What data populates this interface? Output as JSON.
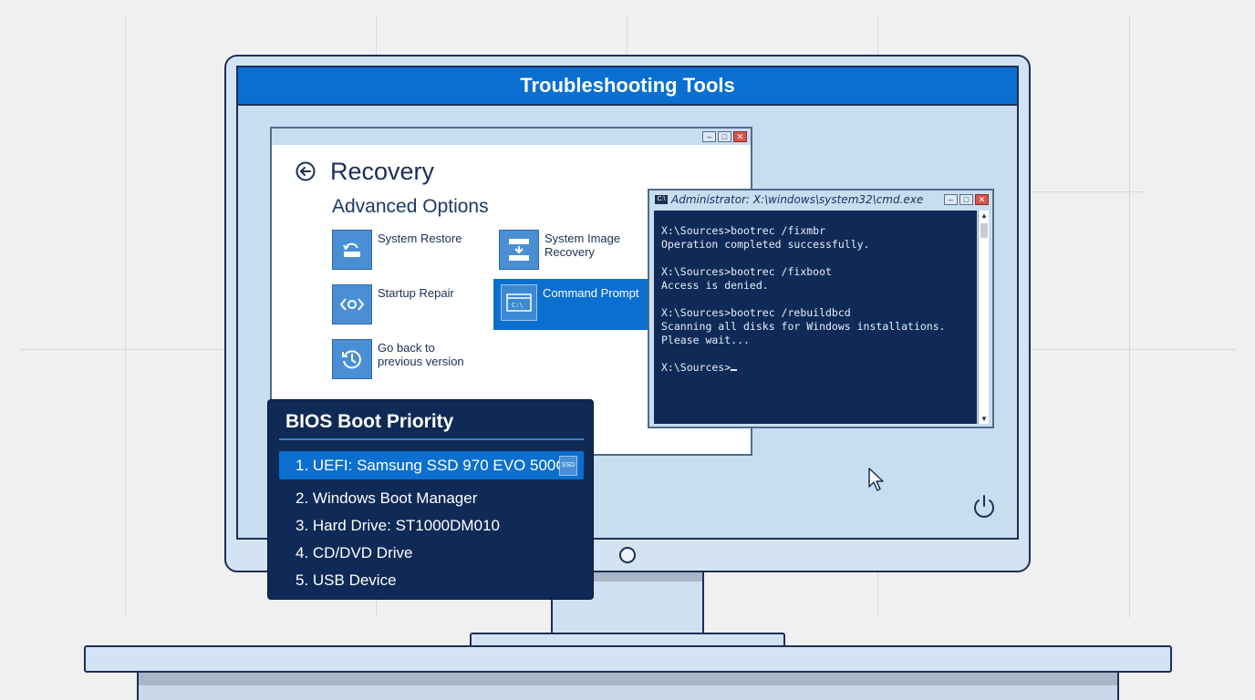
{
  "screen": {
    "title": "Troubleshooting Tools"
  },
  "recovery": {
    "title": "Recovery",
    "subtitle": "Advanced Options",
    "window_controls": {
      "minimize": "–",
      "maximize": "□",
      "close": "✕"
    },
    "options": [
      {
        "label_line1": "System Restore",
        "label_line2": "",
        "icon": "restore-icon",
        "selected": false
      },
      {
        "label_line1": "System Image",
        "label_line2": "Recovery",
        "icon": "image-recovery-icon",
        "selected": false
      },
      {
        "label_line1": "Startup Repair",
        "label_line2": "",
        "icon": "repair-icon",
        "selected": false
      },
      {
        "label_line1": "Command Prompt",
        "label_line2": "",
        "icon": "cmd-icon",
        "selected": true
      },
      {
        "label_line1": "Go back to",
        "label_line2": "previous version",
        "icon": "history-icon",
        "selected": false
      }
    ]
  },
  "cmd": {
    "title": "Administrator: X:\\windows\\system32\\cmd.exe",
    "icon_text": "C:\\",
    "lines": [
      "X:\\Sources>bootrec /fixmbr",
      "Operation completed successfully.",
      "",
      "X:\\Sources>bootrec /fixboot",
      "Access is denied.",
      "",
      "X:\\Sources>bootrec /rebuildbcd",
      "Scanning all disks for Windows installations.",
      "Please wait...",
      "",
      "X:\\Sources>"
    ]
  },
  "bios": {
    "title": "BIOS Boot Priority",
    "items": [
      "1. UEFI: Samsung SSD 970 EVO 500GB",
      "2. Windows Boot Manager",
      "3. Hard Drive: ST1000DM010",
      "4. CD/DVD Drive",
      "5. USB Device"
    ],
    "active_index": 0,
    "badge": "SSD"
  },
  "colors": {
    "accent": "#0b6fcf",
    "navy": "#0f2a57",
    "outline": "#1b2f57",
    "screen_bg": "#c9ddf1"
  }
}
